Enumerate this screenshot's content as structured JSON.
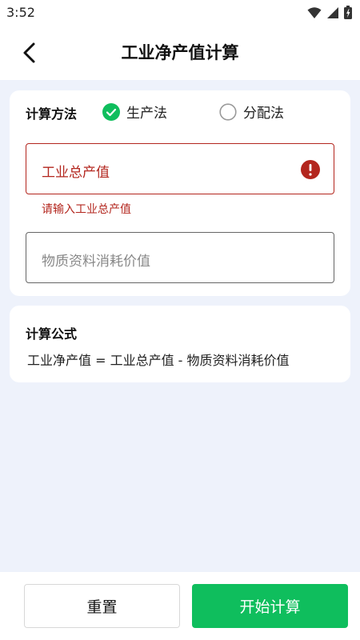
{
  "status_bar": {
    "time": "3:52"
  },
  "header": {
    "title": "工业净产值计算"
  },
  "method": {
    "label": "计算方法",
    "options": [
      {
        "label": "生产法",
        "selected": true
      },
      {
        "label": "分配法",
        "selected": false
      }
    ]
  },
  "fields": {
    "gross_output": {
      "placeholder": "工业总产值",
      "error": "请输入工业总产值"
    },
    "material_consumption": {
      "placeholder": "物质资料消耗价值"
    }
  },
  "formula": {
    "title": "计算公式",
    "text": "工业净产值 = 工业总产值 - 物质资料消耗价值"
  },
  "buttons": {
    "reset": "重置",
    "start": "开始计算"
  },
  "colors": {
    "accent": "#0fbe5d",
    "error": "#b3261e",
    "background": "#eef2fb"
  }
}
